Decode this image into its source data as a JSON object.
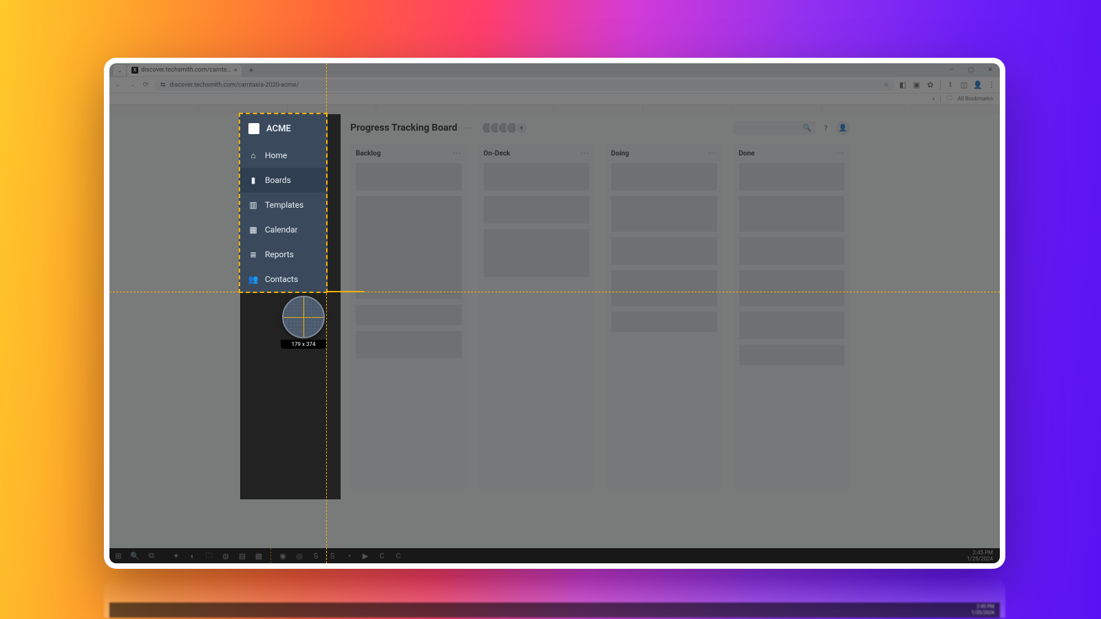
{
  "browser": {
    "tab_title": "discover.techsmith.com/camts…",
    "tab_close": "×",
    "new_tab": "+",
    "url": "discover.techsmith.com/camtasia-2020-acme/",
    "bookmarks_chevrons": "»",
    "bookmarks_all": "All Bookmarks",
    "win_min": "—",
    "win_max": "▢",
    "win_close": "✕"
  },
  "app": {
    "brand": "ACME",
    "nav": [
      {
        "label": "Home",
        "icon": "⌂"
      },
      {
        "label": "Boards",
        "icon": "▮"
      },
      {
        "label": "Templates",
        "icon": "▥"
      },
      {
        "label": "Calendar",
        "icon": "▦"
      },
      {
        "label": "Reports",
        "icon": "≣"
      },
      {
        "label": "Contacts",
        "icon": "👥"
      }
    ],
    "active_index": 1,
    "board_title": "Progress Tracking Board",
    "title_dots": "···",
    "avatars_plus": "+",
    "help": "?",
    "columns": [
      {
        "name": "Backlog"
      },
      {
        "name": "On-Deck"
      },
      {
        "name": "Doing"
      },
      {
        "name": "Done"
      }
    ],
    "col_dots": "···"
  },
  "capture": {
    "size_label": "179 x 374"
  },
  "taskbar": {
    "time": "2:45 PM",
    "date": "1/25/2024"
  }
}
